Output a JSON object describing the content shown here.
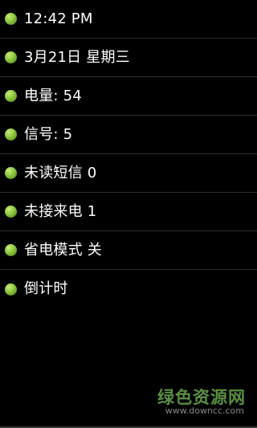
{
  "status_list": {
    "items": [
      {
        "label": "12:42 PM"
      },
      {
        "label": "3月21日 星期三"
      },
      {
        "label": "电量: 54"
      },
      {
        "label": "信号: 5"
      },
      {
        "label": "未读短信 0"
      },
      {
        "label": "未接来电 1"
      },
      {
        "label": "省电模式 关"
      },
      {
        "label": "倒计时"
      }
    ],
    "bullet_icon": "green-dot-icon",
    "bullet_color": "#8cc63f"
  },
  "watermark": {
    "title": "绿色资源网",
    "url": "www.downcc.com",
    "color": "#6aa84f"
  },
  "colors": {
    "background": "#000000",
    "text": "#ffffff",
    "divider": "#2e2e2e"
  }
}
